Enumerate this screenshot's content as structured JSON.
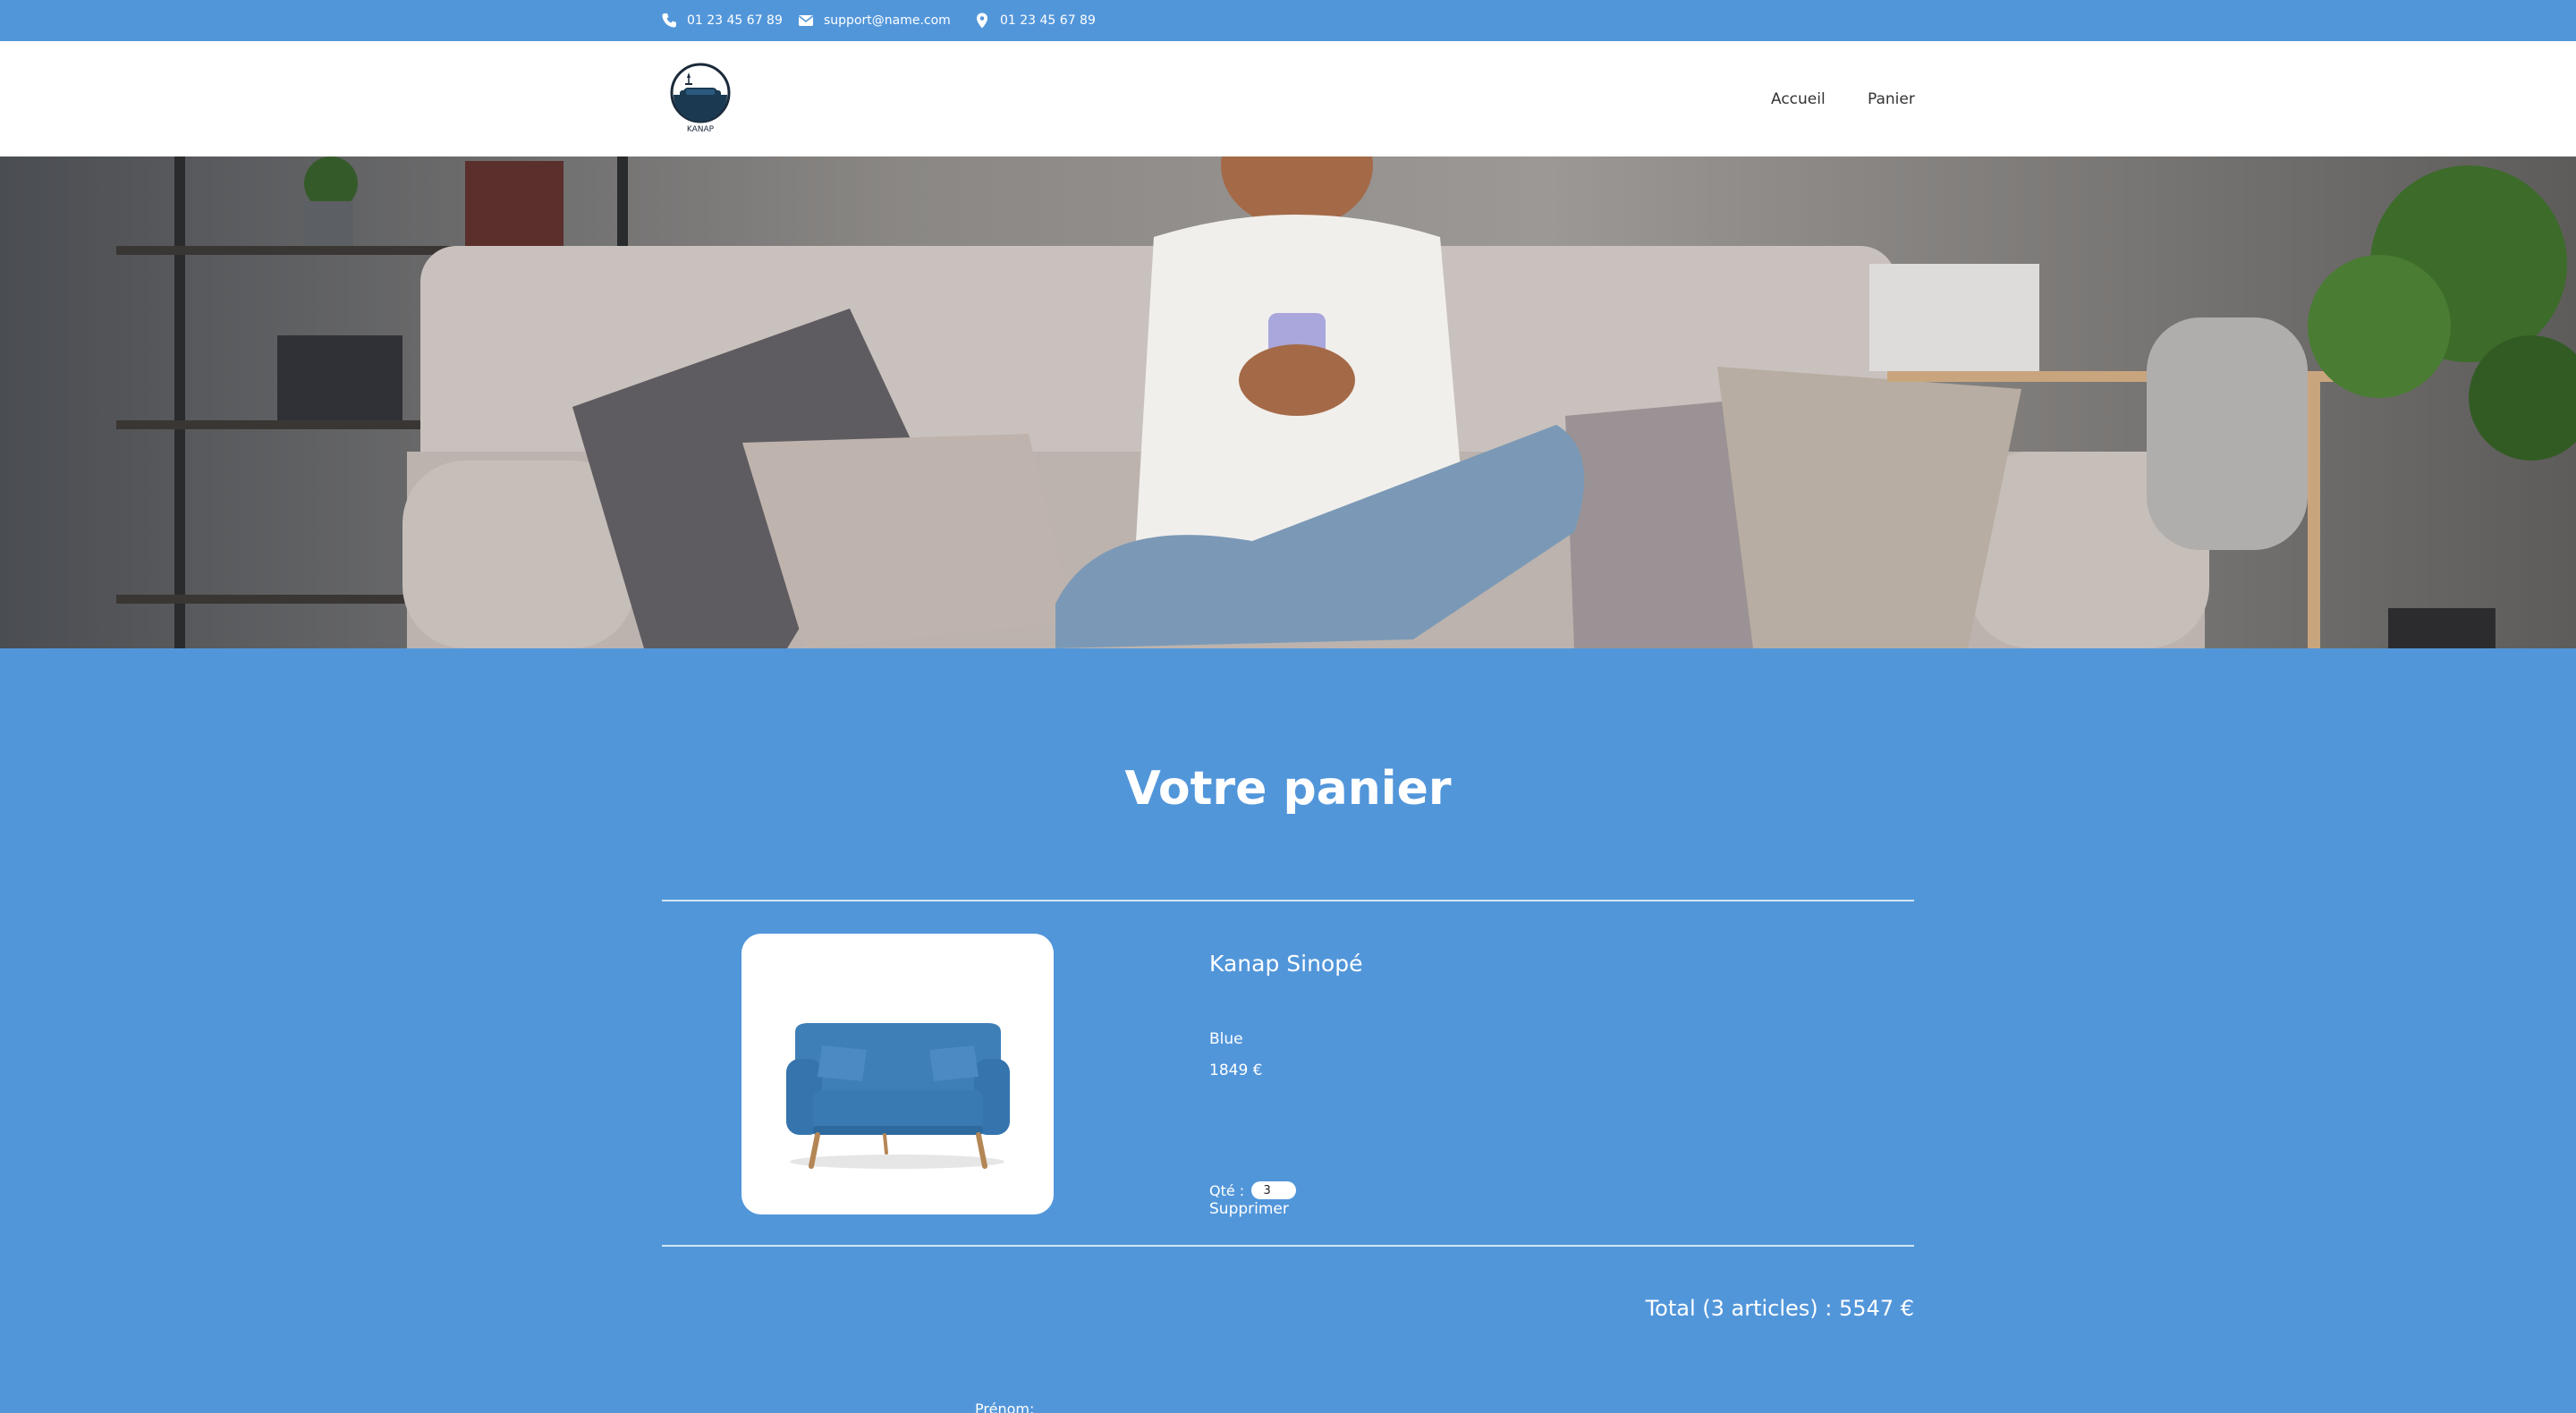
{
  "topbar": {
    "phone": "01 23 45 67 89",
    "email": "support@name.com",
    "location": "01 23 45 67 89",
    "phone_icon": "phone-icon",
    "email_icon": "envelope-icon",
    "location_icon": "map-pin-icon"
  },
  "header": {
    "logo_text": "KANAP",
    "nav": {
      "home": "Accueil",
      "cart": "Panier"
    }
  },
  "cart": {
    "title": "Votre panier",
    "items": [
      {
        "name": "Kanap Sinopé",
        "color": "Blue",
        "price": "1849 €",
        "quantity_label": "Qté : ",
        "quantity": "3",
        "delete_label": "Supprimer"
      }
    ],
    "total_text": "Total (3 articles) : 5547 €"
  },
  "form": {
    "first_name_label": "Prénom:"
  },
  "colors": {
    "brand_blue": "#5296da",
    "header_bg": "#ffffff",
    "text_on_blue": "#ffffff",
    "nav_text": "#333333"
  }
}
